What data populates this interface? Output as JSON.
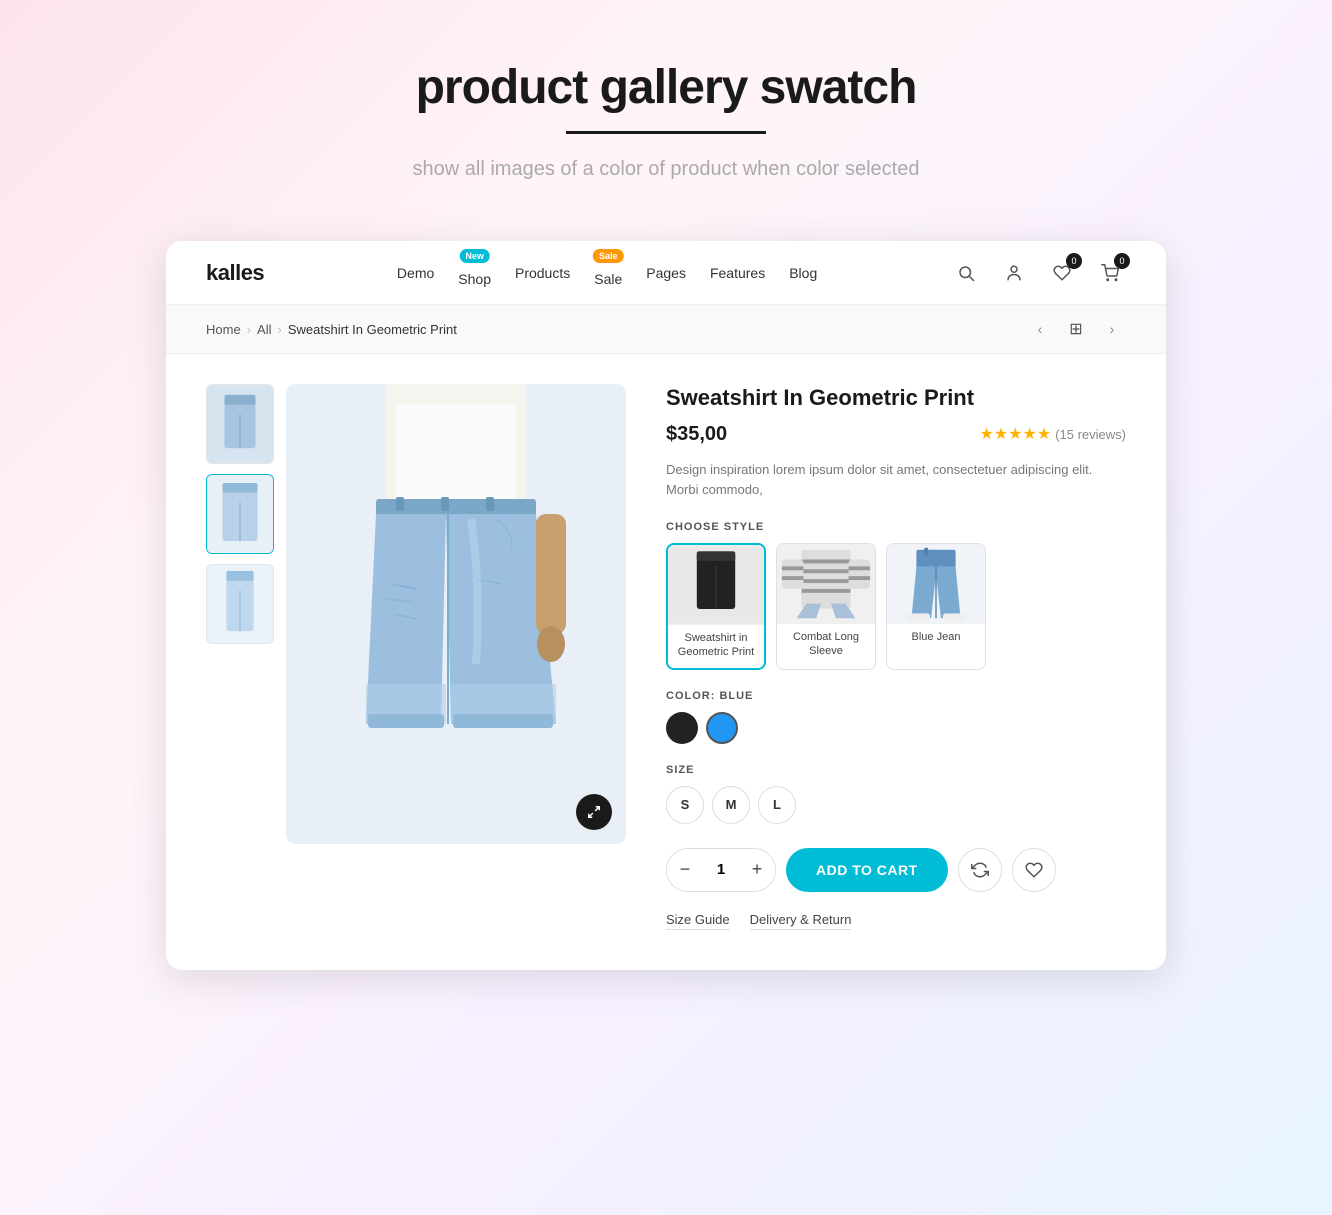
{
  "page": {
    "hero_title": "product gallery swatch",
    "hero_subtitle": "show all images of a color of product when color selected",
    "header_underline": true
  },
  "nav": {
    "logo": "kalles",
    "links": [
      {
        "label": "Demo",
        "badge": null
      },
      {
        "label": "Shop",
        "badge": {
          "text": "New",
          "type": "new"
        }
      },
      {
        "label": "Products",
        "badge": null
      },
      {
        "label": "Sale",
        "badge": {
          "text": "Sale",
          "type": "sale"
        }
      },
      {
        "label": "Pages",
        "badge": null
      },
      {
        "label": "Features",
        "badge": null
      },
      {
        "label": "Blog",
        "badge": null
      }
    ],
    "icons": {
      "search": "🔍",
      "account": "👤",
      "wishlist_count": "0",
      "cart_count": "0"
    }
  },
  "breadcrumb": {
    "home": "Home",
    "all": "All",
    "current": "Sweatshirt In Geometric Print"
  },
  "product": {
    "title": "Sweatshirt In Geometric Print",
    "price": "$35,00",
    "rating": "★★★★★",
    "review_count": "(15 reviews)",
    "description": "Design inspiration lorem ipsum dolor sit amet, consectetuer adipiscing elit. Morbi commodo,",
    "section_style": "CHOOSE STYLE",
    "styles": [
      {
        "label": "Sweatshirt in Geometric Print",
        "active": true
      },
      {
        "label": "Combat Long Sleeve",
        "active": false
      },
      {
        "label": "Blue Jean",
        "active": false
      }
    ],
    "section_color": "COLOR:",
    "color_selected": "BLUE",
    "colors": [
      {
        "name": "black",
        "active": false
      },
      {
        "name": "blue",
        "active": true
      }
    ],
    "section_size": "SIZE",
    "sizes": [
      "S",
      "M",
      "L"
    ],
    "quantity": "1",
    "add_to_cart_label": "ADD TO CART",
    "footer_links": [
      {
        "label": "Size Guide"
      },
      {
        "label": "Delivery & Return"
      }
    ]
  }
}
